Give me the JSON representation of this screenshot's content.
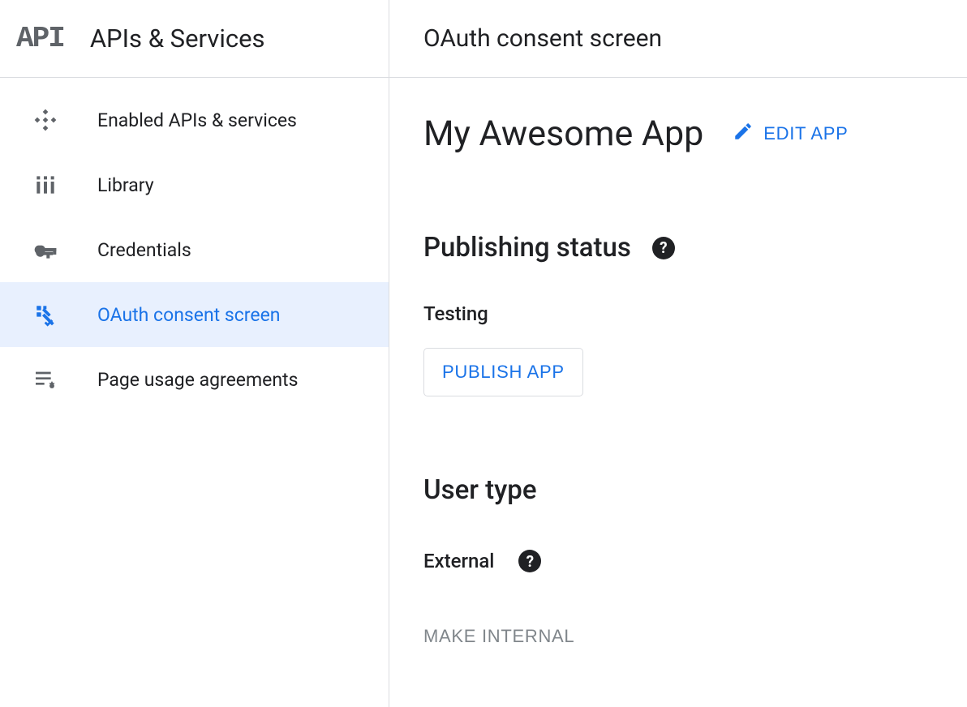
{
  "sidebar": {
    "logo": "API",
    "title": "APIs & Services",
    "items": [
      {
        "label": "Enabled APIs & services"
      },
      {
        "label": "Library"
      },
      {
        "label": "Credentials"
      },
      {
        "label": "OAuth consent screen"
      },
      {
        "label": "Page usage agreements"
      }
    ]
  },
  "header": {
    "title": "OAuth consent screen"
  },
  "app": {
    "name": "My Awesome App",
    "edit_label": "EDIT APP"
  },
  "publishing": {
    "title": "Publishing status",
    "status": "Testing",
    "button": "PUBLISH APP"
  },
  "user_type": {
    "title": "User type",
    "value": "External",
    "button": "MAKE INTERNAL"
  }
}
